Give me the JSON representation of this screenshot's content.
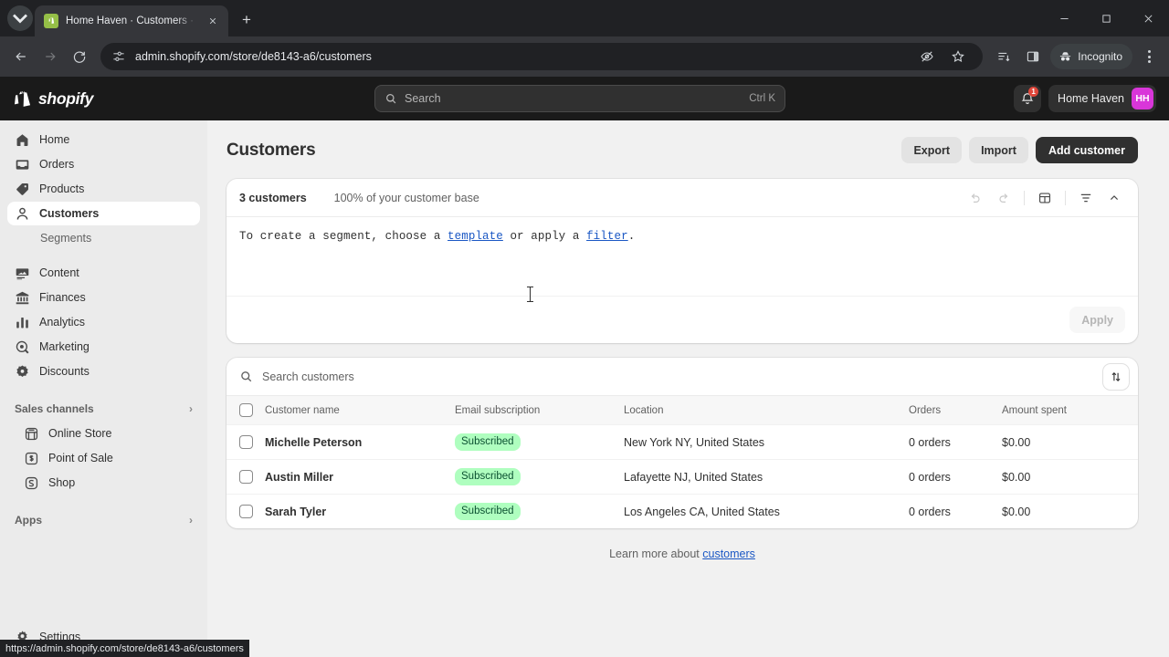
{
  "browser": {
    "tab": {
      "title": "Home Haven · Customers · Sho",
      "favicon_icon": "shopify-favicon",
      "close_icon": "close-icon"
    },
    "tablist_icon": "tab-search-chevron-icon",
    "newtab_label": "+",
    "window": {
      "minimize_icon": "minimize-icon",
      "maximize_icon": "maximize-icon",
      "close_icon": "window-close-icon"
    },
    "nav": {
      "back_icon": "back-arrow-icon",
      "forward_icon": "forward-arrow-icon",
      "reload_icon": "reload-icon"
    },
    "omnibox": {
      "lead_icon": "page-settings-icon",
      "url": "admin.shopify.com/store/de8143-a6/customers",
      "hide_icon": "eye-slash-icon",
      "bookmark_icon": "star-icon"
    },
    "toolbar_right": {
      "downloads_icon": "reading-list-icon",
      "sidepanel_icon": "side-panel-icon",
      "incognito_icon": "incognito-spy-icon",
      "incognito_label": "Incognito",
      "menu_icon": "kebab-menu-icon"
    },
    "statusbar_url": "https://admin.shopify.com/store/de8143-a6/customers"
  },
  "topbar": {
    "logo_icon": "shopify-bag-icon",
    "logo_text": "shopify",
    "search": {
      "icon": "search-icon",
      "placeholder": "Search",
      "shortcut": "Ctrl K"
    },
    "notifications": {
      "icon": "bell-icon",
      "badge": "1"
    },
    "store": {
      "name": "Home Haven",
      "avatar_initials": "HH",
      "avatar_color": "#d936d9"
    }
  },
  "sidebar": {
    "items": [
      {
        "label": "Home",
        "icon": "home-icon",
        "active": false
      },
      {
        "label": "Orders",
        "icon": "orders-inbox-icon",
        "active": false
      },
      {
        "label": "Products",
        "icon": "product-tag-icon",
        "active": false
      },
      {
        "label": "Customers",
        "icon": "person-icon",
        "active": true
      }
    ],
    "sub_item": {
      "label": "Segments"
    },
    "items2": [
      {
        "label": "Content",
        "icon": "content-image-icon"
      },
      {
        "label": "Finances",
        "icon": "bank-icon"
      },
      {
        "label": "Analytics",
        "icon": "bar-chart-icon"
      },
      {
        "label": "Marketing",
        "icon": "megaphone-target-icon"
      },
      {
        "label": "Discounts",
        "icon": "discount-badge-icon"
      }
    ],
    "sales_channels": {
      "label": "Sales channels",
      "chevron_icon": "chevron-right-icon",
      "items": [
        {
          "label": "Online Store",
          "icon": "storefront-icon"
        },
        {
          "label": "Point of Sale",
          "icon": "pos-icon"
        },
        {
          "label": "Shop",
          "icon": "shop-icon"
        }
      ]
    },
    "apps": {
      "label": "Apps",
      "chevron_icon": "chevron-right-icon"
    },
    "settings": {
      "label": "Settings",
      "icon": "gear-icon"
    }
  },
  "main": {
    "page_title": "Customers",
    "actions": {
      "export": "Export",
      "import": "Import",
      "add_customer": "Add customer"
    },
    "segment_card": {
      "count_label": "3 customers",
      "percent_label": "100% of your customer base",
      "tools": {
        "undo_icon": "undo-icon",
        "redo_icon": "redo-icon",
        "template_icon": "template-layout-icon",
        "filter_icon": "filter-icon",
        "collapse_icon": "chevron-up-icon"
      },
      "query_prefix": "To create a segment, choose a ",
      "query_link1": "template",
      "query_middle": " or apply a ",
      "query_link2": "filter",
      "query_suffix": ".",
      "apply_label": "Apply"
    },
    "table_card": {
      "search": {
        "icon": "search-icon",
        "placeholder": "Search customers"
      },
      "sort_icon": "sort-icon",
      "columns": [
        "Customer name",
        "Email subscription",
        "Location",
        "Orders",
        "Amount spent"
      ],
      "rows": [
        {
          "name": "Michelle Peterson",
          "subscription": "Subscribed",
          "location": "New York NY, United States",
          "orders": "0 orders",
          "amount": "$0.00"
        },
        {
          "name": "Austin Miller",
          "subscription": "Subscribed",
          "location": "Lafayette NJ, United States",
          "orders": "0 orders",
          "amount": "$0.00"
        },
        {
          "name": "Sarah Tyler",
          "subscription": "Subscribed",
          "location": "Los Angeles CA, United States",
          "orders": "0 orders",
          "amount": "$0.00"
        }
      ]
    },
    "learn_more_prefix": "Learn more about ",
    "learn_more_link": "customers"
  },
  "colors": {
    "badge_bg": "#affebf",
    "badge_text": "#0c5132",
    "link": "#1a57c4",
    "primary_button": "#303030",
    "notification_badge": "#e0473b"
  }
}
